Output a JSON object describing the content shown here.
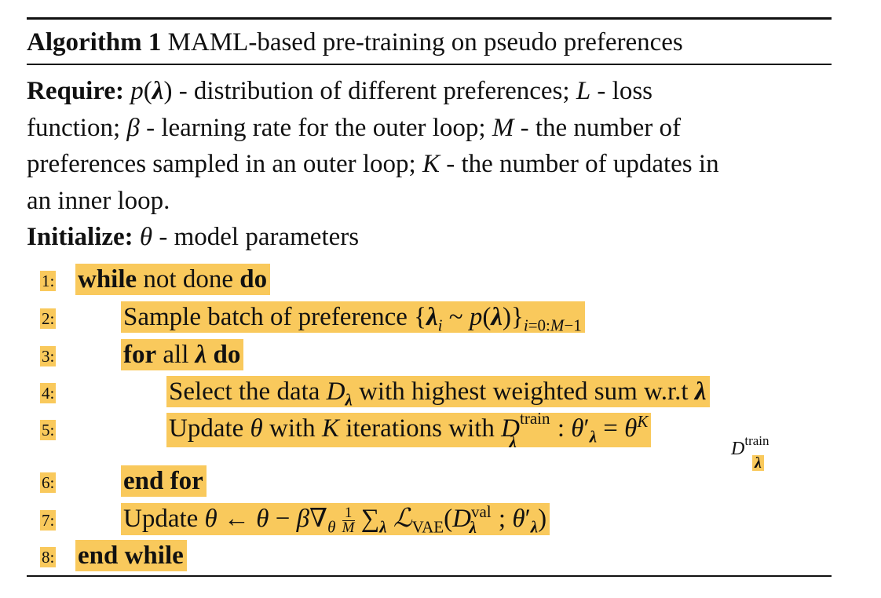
{
  "algorithm": {
    "label": "Algorithm 1",
    "title": "MAML-based pre-training on pseudo preferences"
  },
  "require": {
    "keyword": "Require:",
    "lines": [
      "p(λ) - distribution of different preferences; L - loss",
      "function; β - learning rate for the outer loop; M - the number of",
      "preferences sampled in an outer loop; K - the number of updates in",
      "an inner loop."
    ]
  },
  "initialize": {
    "keyword": "Initialize:",
    "text": "θ - model parameters"
  },
  "steps": [
    {
      "num": "1:",
      "text": "while not done do"
    },
    {
      "num": "2:",
      "text": "Sample batch of preference {λi ~ p(λ)}i=0:M−1"
    },
    {
      "num": "3:",
      "text": "for all λ do"
    },
    {
      "num": "4:",
      "text": "Select the data Dλ with highest weighted sum w.r.t λ"
    },
    {
      "num": "5:",
      "text": "Update θ with K iterations with Dλtrain: θ′λ = θK Dλtrain"
    },
    {
      "num": "6:",
      "text": "end for"
    },
    {
      "num": "7:",
      "text": "Update θ ← θ − β∇θ 1/M Σλ ℒVAE(Dλval; θ′λ)"
    },
    {
      "num": "8:",
      "text": "end while"
    }
  ],
  "colors": {
    "highlight": "#f9c95c",
    "text": "#111111"
  }
}
